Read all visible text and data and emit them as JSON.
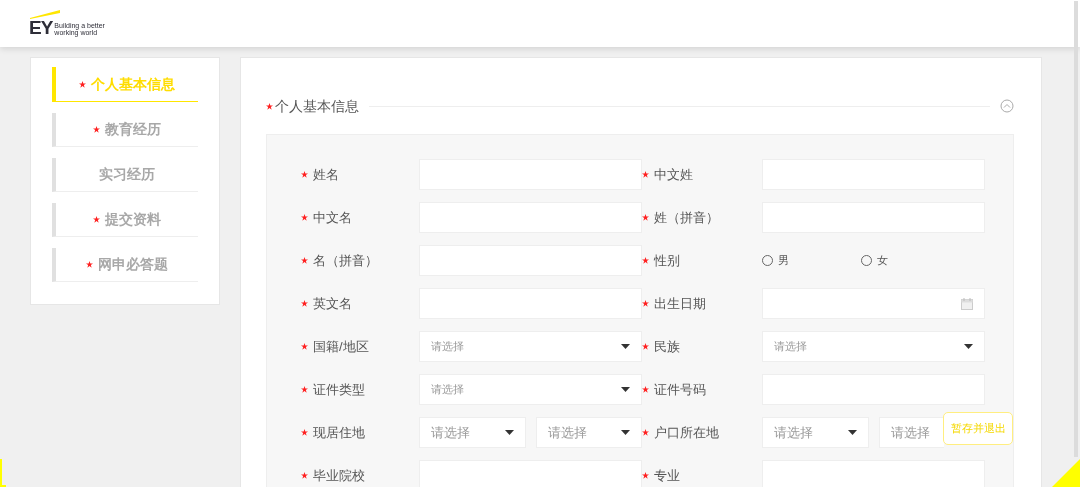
{
  "header": {
    "logo": {
      "mark": "EY",
      "tagline": [
        "Building a better",
        "working world"
      ]
    }
  },
  "sidebar": {
    "items": [
      {
        "label": "个人基本信息",
        "required": true,
        "selected": true
      },
      {
        "label": "教育经历",
        "required": true,
        "selected": false
      },
      {
        "label": "实习经历",
        "required": false,
        "selected": false
      },
      {
        "label": "提交资料",
        "required": true,
        "selected": false
      },
      {
        "label": "网申必答题",
        "required": true,
        "selected": false
      }
    ]
  },
  "section": {
    "title": "个人基本信息",
    "required": true,
    "expanded": true
  },
  "form": {
    "fields": [
      {
        "label": "姓名",
        "required": true,
        "kind": "text"
      },
      {
        "label": "中文姓",
        "required": true,
        "kind": "text"
      },
      {
        "label": "中文名",
        "required": true,
        "kind": "text"
      },
      {
        "label": "姓（拼音）",
        "required": true,
        "kind": "text"
      },
      {
        "label": "名（拼音）",
        "required": true,
        "kind": "text"
      },
      {
        "label": "性别",
        "required": true,
        "kind": "radio",
        "options": [
          {
            "label": "男",
            "selected": false
          },
          {
            "label": "女",
            "selected": false
          }
        ]
      },
      {
        "label": "英文名",
        "required": true,
        "kind": "text"
      },
      {
        "label": "出生日期",
        "required": true,
        "kind": "date"
      },
      {
        "label": "国籍/地区",
        "required": true,
        "kind": "select",
        "placeholder": "请选择"
      },
      {
        "label": "民族",
        "required": true,
        "kind": "select",
        "placeholder": "请选择"
      },
      {
        "label": "证件类型",
        "required": true,
        "kind": "select",
        "placeholder": "请选择"
      },
      {
        "label": "证件号码",
        "required": true,
        "kind": "text"
      },
      {
        "label": "现居住地",
        "required": true,
        "kind": "double_select",
        "placeholders": [
          "请选择",
          "请选择"
        ]
      },
      {
        "label": "户口所在地",
        "required": true,
        "kind": "double_select",
        "placeholders": [
          "请选择",
          "请选择"
        ]
      },
      {
        "label": "毕业院校",
        "required": true,
        "kind": "text"
      },
      {
        "label": "专业",
        "required": true,
        "kind": "text"
      }
    ]
  },
  "save_button": {
    "label": "暂存并退出"
  }
}
